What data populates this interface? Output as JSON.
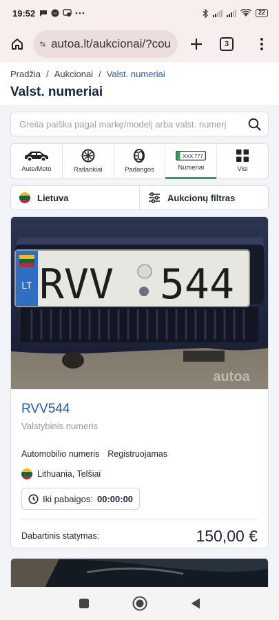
{
  "status": {
    "time": "19:52",
    "battery": "22"
  },
  "browser": {
    "url": "autoa.lt/aukcionai/?cou",
    "tab_count": "3"
  },
  "breadcrumb": {
    "items": [
      "Pradžia",
      "Aukcionai",
      "Valst. numeriai"
    ],
    "separator": "/"
  },
  "page_title": "Valst. numeriai",
  "search": {
    "placeholder": "Greita paiška pagal markę/modelį arba valst. numerį"
  },
  "categories": [
    {
      "label": "Auto/Moto",
      "icon": "car-icon"
    },
    {
      "label": "Ratlankiai",
      "icon": "rim-icon"
    },
    {
      "label": "Padangos",
      "icon": "tire-icon"
    },
    {
      "label": "Numeriai",
      "icon": "license-plate-icon",
      "plate_text": "XXX 777",
      "active": true
    },
    {
      "label": "Visi",
      "icon": "grid-icon"
    }
  ],
  "filters": {
    "country": "Lietuva",
    "auction_filter": "Aukcionų filtras"
  },
  "listing": {
    "plate": {
      "country_code": "LT",
      "letters": "RVV",
      "digits": "544"
    },
    "watermark": "autoa",
    "title": "RVV544",
    "subtitle": "Valstybinis numeris",
    "tags": [
      "Automobilio numeris",
      "Registruojamas"
    ],
    "location": "Lithuania, Telšiai",
    "timer_label": "Iki pabaigos:",
    "timer_value": "00:00:00",
    "bid_label": "Dabartinis statymas:",
    "bid_value": "150,00 €"
  },
  "colors": {
    "accent_blue": "#1d59b5",
    "active_green": "#25a55a",
    "flag_yellow": "#fdb913",
    "flag_green": "#006a44",
    "flag_red": "#c1272d"
  }
}
